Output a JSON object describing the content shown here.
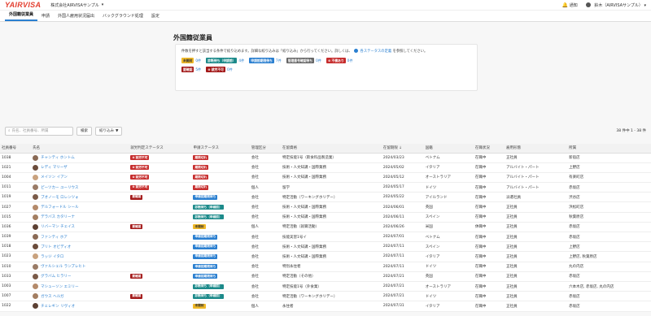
{
  "header": {
    "logo": "YAIRVISA",
    "company": "株式会社AIRVISAサンプル",
    "notice_label": "通知",
    "user_name": "鈴木（AIRVISAサンプル）"
  },
  "tabs": [
    {
      "label": "外国籍従業員",
      "active": true
    },
    {
      "label": "申請",
      "active": false
    },
    {
      "label": "外国人雇用状況届出",
      "active": false
    },
    {
      "label": "バックグラウンド処理",
      "active": false
    },
    {
      "label": "設定",
      "active": false
    }
  ],
  "page_title": "外国籍従業員",
  "filter": {
    "description": "件数を押すと該当する条件で絞り込めます。詳細な絞り込みは「絞り込み」から行ってください。詳しくは、",
    "link_text": "各ステータスの定義",
    "description_end": "を参照してください。",
    "chips": [
      {
        "label": "未開封",
        "count": "0件",
        "color": "yellow"
      },
      {
        "label": "診断待ち（申請前）",
        "count": "4件",
        "color": "teal"
      },
      {
        "label": "申請前期限待ち",
        "count": "7件",
        "color": "blue"
      },
      {
        "label": "管理番号確認待ち",
        "count": "0件",
        "color": "gray"
      },
      {
        "label": "不備あり",
        "count": "0件",
        "color": "red"
      },
      {
        "label": "要確認",
        "count": "5件",
        "color": "dred"
      },
      {
        "label": "就労不可",
        "count": "0件",
        "color": "dred"
      }
    ]
  },
  "toolbar": {
    "search_placeholder": "氏名、社員番号、所属",
    "search_button": "検索",
    "filter_button": "絞り込み",
    "count": "38 件中 1 - 38 件"
  },
  "table": {
    "columns": [
      "社員番号",
      "氏名",
      "就労判定ステータス",
      "申請ステータス",
      "管理区分",
      "在留資格",
      "在留期限",
      "国籍",
      "在職状況",
      "雇用形態",
      "所属"
    ],
    "rows": [
      {
        "id": "1038",
        "name": "チャンティ ホントム",
        "judge": {
          "label": "就労不可",
          "color": "red"
        },
        "apply": {
          "label": "期限切れ",
          "color": "red"
        },
        "mgmt": "会社",
        "status": "特定技能1号（飲食料品製造業）",
        "expiry": "2024/03/23",
        "nation": "ベトナム",
        "work": "在職中",
        "employ": "正社員",
        "dept": "新宿店"
      },
      {
        "id": "1021",
        "name": "レディ マリーザ",
        "judge": {
          "label": "就労不可",
          "color": "red"
        },
        "apply": {
          "label": "期限切れ",
          "color": "red"
        },
        "mgmt": "会社",
        "status": "技術・人文知識・国際業務",
        "expiry": "2024/05/02",
        "nation": "イタリア",
        "work": "在職中",
        "employ": "アルバイト・パート",
        "dept": "上野店"
      },
      {
        "id": "1004",
        "name": "メイソン イアン",
        "judge": {
          "label": "就労不可",
          "color": "red"
        },
        "apply": {
          "label": "期限切れ",
          "color": "red"
        },
        "mgmt": "会社",
        "status": "技術・人文知識・国際業務",
        "expiry": "2024/05/12",
        "nation": "オーストラリア",
        "work": "在職中",
        "employ": "アルバイト・パート",
        "dept": "有楽町店"
      },
      {
        "id": "1011",
        "name": "ピーツカー ユーリウス",
        "judge": {
          "label": "就労不可",
          "color": "red"
        },
        "apply": {
          "label": "期限切れ",
          "color": "red"
        },
        "mgmt": "個人",
        "status": "留学",
        "expiry": "2024/05/17",
        "nation": "ドイツ",
        "work": "在職中",
        "employ": "アルバイト・パート",
        "dept": "赤坂店"
      },
      {
        "id": "1019",
        "name": "ブオノーモ ロレンツォ",
        "judge": {
          "label": "要確認",
          "color": "dred"
        },
        "apply": {
          "label": "申請前期限待ち",
          "color": "blue"
        },
        "mgmt": "会社",
        "status": "特定活動（ワーキングホリデー）",
        "expiry": "2024/05/22",
        "nation": "アイルランド",
        "work": "在職中",
        "employ": "派遣社員",
        "dept": "渋谷店"
      },
      {
        "id": "1027",
        "name": "デルフォードル シール",
        "judge": {
          "label": "",
          "color": ""
        },
        "apply": {
          "label": "診断待ち（申請前）",
          "color": "teal"
        },
        "mgmt": "会社",
        "status": "技術・人文知識・国際業務",
        "expiry": "2024/06/01",
        "nation": "英国",
        "work": "在職中",
        "employ": "正社員",
        "dept": "浜松町店"
      },
      {
        "id": "1015",
        "name": "デラバス カタリーナ",
        "judge": {
          "label": "",
          "color": ""
        },
        "apply": {
          "label": "診断待ち（申請前）",
          "color": "teal"
        },
        "mgmt": "会社",
        "status": "技術・人文知識・国際業務",
        "expiry": "2024/06/11",
        "nation": "スペイン",
        "work": "在職中",
        "employ": "正社員",
        "dept": "秋葉原店"
      },
      {
        "id": "1036",
        "name": "リバーマン チェイス",
        "judge": {
          "label": "要確認",
          "color": "dred"
        },
        "apply": {
          "label": "未開封",
          "color": "yellow"
        },
        "mgmt": "個人",
        "status": "特定活動（就職活動）",
        "expiry": "2024/06/26",
        "nation": "米国",
        "work": "休職中",
        "employ": "正社員",
        "dept": "赤坂店"
      },
      {
        "id": "1039",
        "name": "ファンティ ホア",
        "judge": {
          "label": "",
          "color": ""
        },
        "apply": {
          "label": "申請前期限待ち",
          "color": "blue"
        },
        "mgmt": "会社",
        "status": "技能実習1号イ",
        "expiry": "2024/07/01",
        "nation": "ベトナム",
        "work": "在職中",
        "employ": "正社員",
        "dept": "赤坂店"
      },
      {
        "id": "1018",
        "name": "ブリト オビディオ",
        "judge": {
          "label": "",
          "color": ""
        },
        "apply": {
          "label": "申請前期限待ち",
          "color": "blue"
        },
        "mgmt": "会社",
        "status": "技術・人文知識・国際業務",
        "expiry": "2024/07/11",
        "nation": "スペイン",
        "work": "在職中",
        "employ": "正社員",
        "dept": "上野店"
      },
      {
        "id": "1023",
        "name": "ラッジ イタロ",
        "judge": {
          "label": "",
          "color": ""
        },
        "apply": {
          "label": "申請前期限待ち",
          "color": "blue"
        },
        "mgmt": "会社",
        "status": "技術・人文知識・国際業務",
        "expiry": "2024/07/11",
        "nation": "イタリア",
        "work": "在職中",
        "employ": "正社員",
        "dept": "上野店, 秋葉原店"
      },
      {
        "id": "1010",
        "name": "ヴァルシェル ランプレヒト",
        "judge": {
          "label": "",
          "color": ""
        },
        "apply": {
          "label": "申請前期限待ち",
          "color": "blue"
        },
        "mgmt": "会社",
        "status": "特別永住者",
        "expiry": "2024/07/11",
        "nation": "ドイツ",
        "work": "在職中",
        "employ": "正社員",
        "dept": "丸の内店"
      },
      {
        "id": "1033",
        "name": "グラバム ヒラリー",
        "judge": {
          "label": "要確認",
          "color": "dred"
        },
        "apply": {
          "label": "申請前期限待ち",
          "color": "blue"
        },
        "mgmt": "会社",
        "status": "特定活動（その他）",
        "expiry": "2024/07/21",
        "nation": "英国",
        "work": "在職中",
        "employ": "正社員",
        "dept": "赤坂店"
      },
      {
        "id": "1003",
        "name": "マシューソン エミリー",
        "judge": {
          "label": "",
          "color": ""
        },
        "apply": {
          "label": "診断待ち（申請前）",
          "color": "teal"
        },
        "mgmt": "会社",
        "status": "特定技能1号（外食業）",
        "expiry": "2024/07/21",
        "nation": "オーストラリア",
        "work": "在職中",
        "employ": "正社員",
        "dept": "六本木店, 赤坂店, 丸の内店"
      },
      {
        "id": "1007",
        "name": "ガウス ヘルガ",
        "judge": {
          "label": "要確認",
          "color": "dred"
        },
        "apply": {
          "label": "診断待ち（申請前）",
          "color": "teal"
        },
        "mgmt": "会社",
        "status": "特定活動（ワーキングホリデー）",
        "expiry": "2024/07/21",
        "nation": "ドイツ",
        "work": "在職中",
        "employ": "正社員",
        "dept": "赤坂店"
      },
      {
        "id": "1022",
        "name": "チェレギン リヴィオ",
        "judge": {
          "label": "",
          "color": ""
        },
        "apply": {
          "label": "未開封",
          "color": "yellow"
        },
        "mgmt": "個人",
        "status": "永住者",
        "expiry": "2024/07/31",
        "nation": "イタリア",
        "work": "在職中",
        "employ": "正社員",
        "dept": "赤坂店"
      }
    ]
  }
}
